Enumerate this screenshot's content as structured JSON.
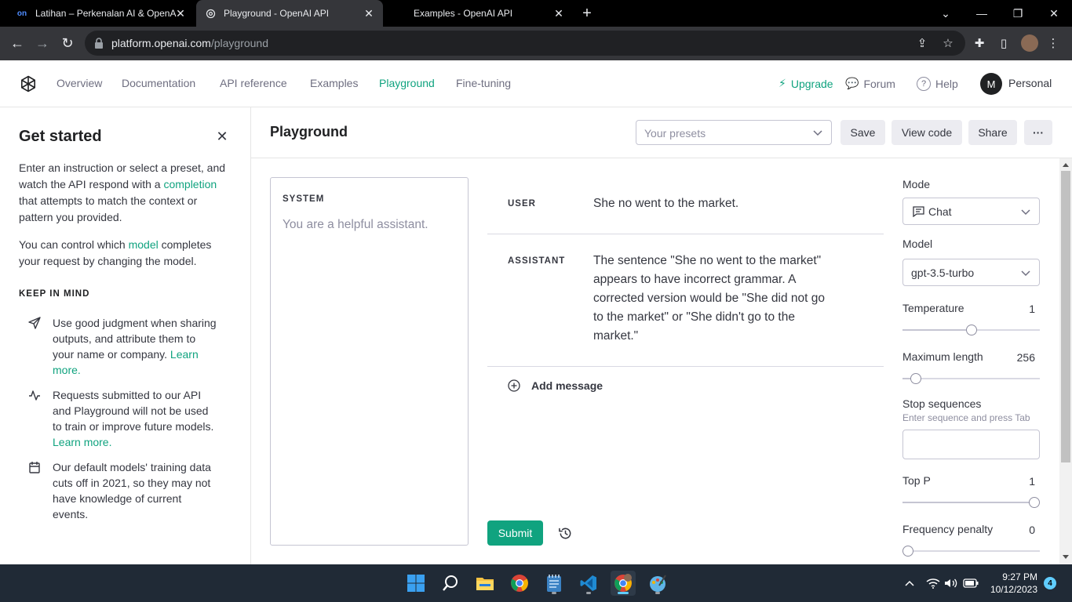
{
  "browser": {
    "tabs": [
      {
        "title": "Latihan – Perkenalan AI & OpenAI",
        "active": false
      },
      {
        "title": "Playground - OpenAI API",
        "active": true
      },
      {
        "title": "Examples - OpenAI API",
        "active": false
      }
    ],
    "url_host": "platform.openai.com",
    "url_path": "/playground"
  },
  "header": {
    "nav": [
      "Overview",
      "Documentation",
      "API reference",
      "Examples",
      "Playground",
      "Fine-tuning"
    ],
    "active_nav": "Playground",
    "upgrade": "Upgrade",
    "forum": "Forum",
    "help": "Help",
    "avatar_initial": "M",
    "account": "Personal"
  },
  "sidebar": {
    "title": "Get started",
    "intro_before": "Enter an instruction or select a preset, and watch the API respond with a ",
    "intro_link": "completion",
    "intro_after": " that attempts to match the context or pattern you provided.",
    "model_before": "You can control which ",
    "model_link": "model",
    "model_after": " completes your request by changing the model.",
    "keep_in_mind": "KEEP IN MIND",
    "tips": [
      {
        "icon": "send-icon",
        "text": "Use good judgment when sharing outputs, and attribute them to your name or company. ",
        "link": "Learn more."
      },
      {
        "icon": "activity-icon",
        "text": "Requests submitted to our API and Playground will not be used to train or improve future models. ",
        "link": "Learn more."
      },
      {
        "icon": "calendar-icon",
        "text": "Our default models' training data cuts off in 2021, so they may not have knowledge of current events.",
        "link": ""
      }
    ]
  },
  "main": {
    "title": "Playground",
    "presets_placeholder": "Your presets",
    "save": "Save",
    "view_code": "View code",
    "share": "Share",
    "more": "···",
    "system_label": "SYSTEM",
    "system_placeholder": "You are a helpful assistant.",
    "messages": [
      {
        "role": "USER",
        "text": "She no went to the market."
      },
      {
        "role": "ASSISTANT",
        "text": "The sentence \"She no went to the market\" appears to have incorrect grammar. A corrected version would be \"She did not go to the market\" or \"She didn't go to the market.\""
      }
    ],
    "add_message": "Add message",
    "submit": "Submit"
  },
  "settings": {
    "mode_label": "Mode",
    "mode_value": "Chat",
    "model_label": "Model",
    "model_value": "gpt-3.5-turbo",
    "temperature_label": "Temperature",
    "temperature_value": "1",
    "temperature_fraction": 0.5,
    "max_length_label": "Maximum length",
    "max_length_value": "256",
    "max_length_fraction": 0.06,
    "stop_label": "Stop sequences",
    "stop_hint": "Enter sequence and press Tab",
    "top_p_label": "Top P",
    "top_p_value": "1",
    "top_p_fraction": 1.0,
    "freq_label": "Frequency penalty",
    "freq_value": "0",
    "freq_fraction": 0.0
  },
  "taskbar": {
    "time": "9:27 PM",
    "date": "10/12/2023",
    "notifications": "4"
  },
  "colors": {
    "accent": "#10a37f",
    "text": "#353740",
    "muted": "#8e8ea0"
  }
}
